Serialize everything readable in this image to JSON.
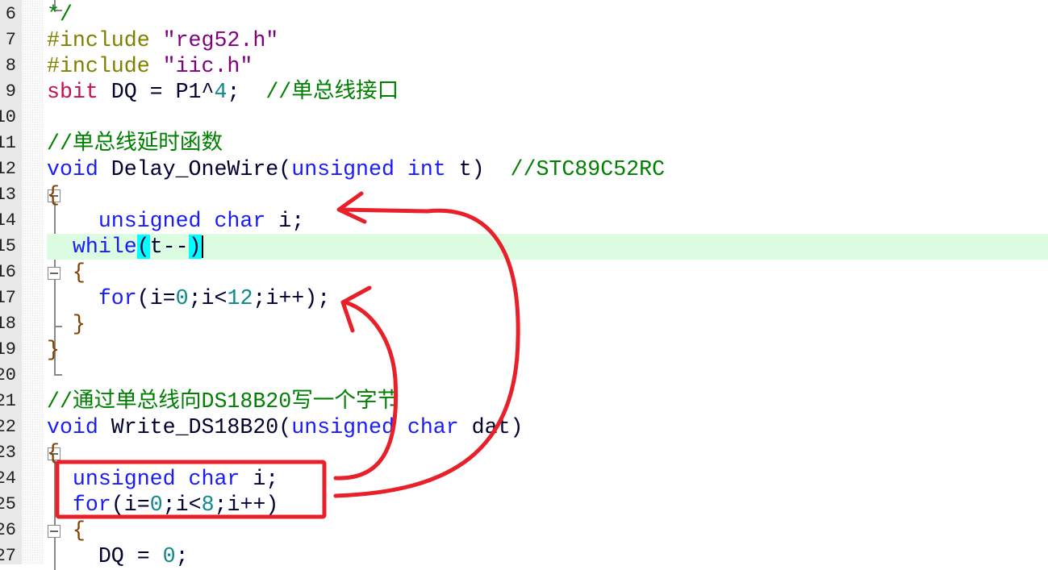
{
  "editor": {
    "current_line": 15,
    "colors": {
      "keyword": "#1a1aff",
      "preprocessor": "#808000",
      "string": "#800080",
      "type": "#c8104a",
      "comment": "#008000",
      "number": "#0a8a8a",
      "current_line_bg": "#dcfce2",
      "brace_match": "#00ffff",
      "annotation": "#e8202a"
    },
    "lines": [
      {
        "n": "6",
        "t": [
          [
            "cm",
            "*/"
          ]
        ]
      },
      {
        "n": "7",
        "t": [
          [
            "pp",
            "#include "
          ],
          [
            "str",
            "\"reg52.h\""
          ]
        ]
      },
      {
        "n": "8",
        "t": [
          [
            "pp",
            "#include "
          ],
          [
            "str",
            "\"iic.h\""
          ]
        ]
      },
      {
        "n": "9",
        "t": [
          [
            "typ",
            "sbit"
          ],
          [
            "id",
            " DQ = P1^"
          ],
          [
            "num",
            "4"
          ],
          [
            "id",
            ";  "
          ],
          [
            "cm",
            "//单总线接口"
          ]
        ]
      },
      {
        "n": "10",
        "t": []
      },
      {
        "n": "11",
        "t": [
          [
            "cm",
            "//单总线延时函数"
          ]
        ]
      },
      {
        "n": "12",
        "t": [
          [
            "kw",
            "void"
          ],
          [
            "id",
            " Delay_OneWire("
          ],
          [
            "kw",
            "unsigned int"
          ],
          [
            "id",
            " t)  "
          ],
          [
            "cm",
            "//STC89C52RC"
          ]
        ]
      },
      {
        "n": "13",
        "t": [
          [
            "br",
            "{"
          ]
        ]
      },
      {
        "n": "14",
        "t": [
          [
            "id",
            "    "
          ],
          [
            "kw",
            "unsigned char"
          ],
          [
            "id",
            " i;"
          ]
        ]
      },
      {
        "n": "15",
        "t": [
          [
            "id",
            "  "
          ],
          [
            "kw",
            "while"
          ],
          [
            "hl",
            "("
          ],
          [
            "id",
            "t--"
          ],
          [
            "hl",
            ")"
          ],
          [
            "caret",
            ""
          ]
        ]
      },
      {
        "n": "16",
        "t": [
          [
            "br",
            "  {"
          ]
        ]
      },
      {
        "n": "17",
        "t": [
          [
            "id",
            "    "
          ],
          [
            "kw",
            "for"
          ],
          [
            "id",
            "(i="
          ],
          [
            "num",
            "0"
          ],
          [
            "id",
            ";i<"
          ],
          [
            "num",
            "12"
          ],
          [
            "id",
            ";i++);"
          ]
        ]
      },
      {
        "n": "18",
        "t": [
          [
            "br",
            "  }"
          ]
        ]
      },
      {
        "n": "19",
        "t": [
          [
            "br",
            "}"
          ]
        ]
      },
      {
        "n": "20",
        "t": []
      },
      {
        "n": "21",
        "t": [
          [
            "cm",
            "//通过单总线向DS18B20写一个字节"
          ]
        ]
      },
      {
        "n": "22",
        "t": [
          [
            "kw",
            "void"
          ],
          [
            "id",
            " Write_DS18B20("
          ],
          [
            "kw",
            "unsigned char"
          ],
          [
            "id",
            " dat)"
          ]
        ]
      },
      {
        "n": "23",
        "t": [
          [
            "br",
            "{"
          ]
        ]
      },
      {
        "n": "24",
        "t": [
          [
            "id",
            "  "
          ],
          [
            "kw",
            "unsigned char"
          ],
          [
            "id",
            " i;"
          ]
        ]
      },
      {
        "n": "25",
        "t": [
          [
            "id",
            "  "
          ],
          [
            "kw",
            "for"
          ],
          [
            "id",
            "(i="
          ],
          [
            "num",
            "0"
          ],
          [
            "id",
            ";i<"
          ],
          [
            "num",
            "8"
          ],
          [
            "id",
            ";i++)"
          ]
        ]
      },
      {
        "n": "26",
        "t": [
          [
            "br",
            "  {"
          ]
        ]
      },
      {
        "n": "27",
        "t": [
          [
            "id",
            "    DQ = "
          ],
          [
            "num",
            "0"
          ],
          [
            "id",
            ";"
          ]
        ]
      }
    ]
  }
}
